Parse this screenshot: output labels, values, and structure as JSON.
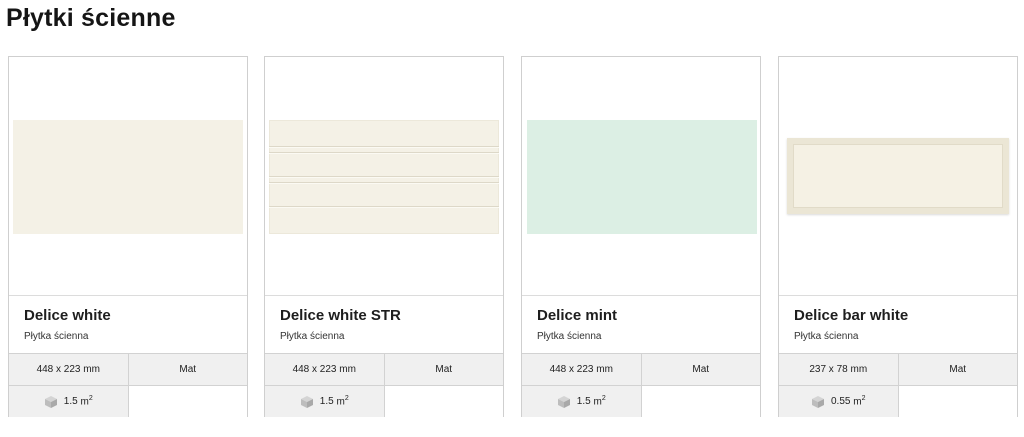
{
  "page": {
    "title": "Płytki ścienne"
  },
  "products": [
    {
      "name": "Delice white",
      "category": "Płytka ścienna",
      "dimensions": "448 x 223 mm",
      "finish": "Mat",
      "package_area": "1.5",
      "unit": "m",
      "unit_exp": "2",
      "swatch": "#f4f1e6"
    },
    {
      "name": "Delice white STR",
      "category": "Płytka ścienna",
      "dimensions": "448 x 223 mm",
      "finish": "Mat",
      "package_area": "1.5",
      "unit": "m",
      "unit_exp": "2",
      "swatch": "#f4f1e6"
    },
    {
      "name": "Delice mint",
      "category": "Płytka ścienna",
      "dimensions": "448 x 223 mm",
      "finish": "Mat",
      "package_area": "1.5",
      "unit": "m",
      "unit_exp": "2",
      "swatch": "#dcefe4"
    },
    {
      "name": "Delice bar white",
      "category": "Płytka ścienna",
      "dimensions": "237 x 78 mm",
      "finish": "Mat",
      "package_area": "0.55",
      "unit": "m",
      "unit_exp": "2",
      "swatch": "#f5f1e4"
    }
  ],
  "icons": {
    "package": "box-icon"
  },
  "colors": {
    "border": "#cfcfcf",
    "spec_bg": "#f0f0f0",
    "text": "#1a1a1a"
  }
}
